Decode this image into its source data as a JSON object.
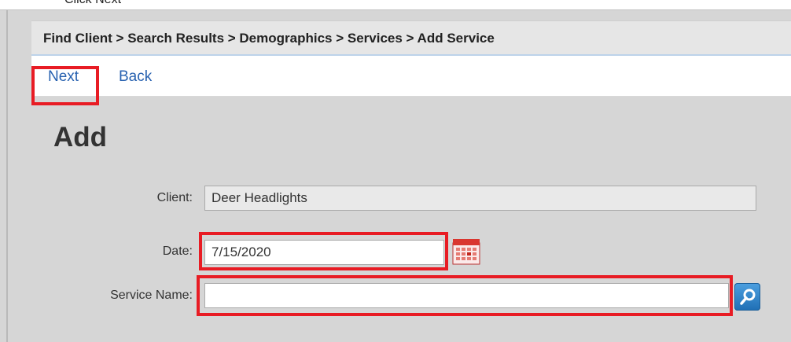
{
  "caption": "Click Next",
  "breadcrumb": "Find Client > Search Results > Demographics > Services > Add Service",
  "actions": {
    "next_label": "Next",
    "back_label": "Back"
  },
  "page_title": "Add",
  "form": {
    "client_label": "Client:",
    "client_value": "Deer Headlights",
    "date_label": "Date:",
    "date_value": "7/15/2020",
    "service_label": "Service Name:",
    "service_value": ""
  },
  "icons": {
    "calendar": "calendar-icon",
    "lookup": "magnifier-lookup-icon"
  },
  "colors": {
    "highlight": "#e81c24",
    "link": "#2761b0",
    "lookup_button": "#1f6fb5"
  }
}
